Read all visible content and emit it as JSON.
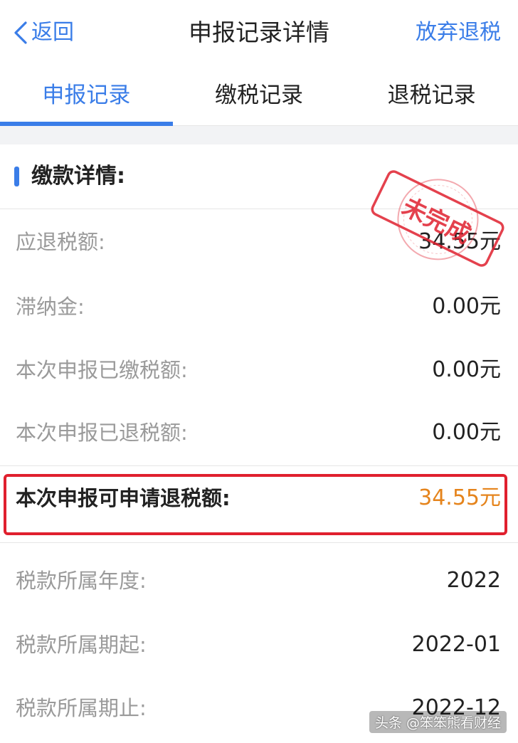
{
  "navbar": {
    "back_label": "返回",
    "title": "申报记录详情",
    "action_label": "放弃退税"
  },
  "tabs": [
    {
      "label": "申报记录",
      "active": true
    },
    {
      "label": "缴税记录",
      "active": false
    },
    {
      "label": "退税记录",
      "active": false
    }
  ],
  "section": {
    "title": "缴款详情:"
  },
  "stamp": {
    "text": "未完成",
    "color": "#e0202e"
  },
  "rows": [
    {
      "label": "应退税额:",
      "value": "34.55元"
    },
    {
      "label": "滞纳金:",
      "value": "0.00元"
    },
    {
      "label": "本次申报已缴税额:",
      "value": "0.00元"
    },
    {
      "label": "本次申报已退税额:",
      "value": "0.00元"
    },
    {
      "label": "本次申报可申请退税额:",
      "value": "34.55元",
      "highlighted": true
    },
    {
      "label": "税款所属年度:",
      "value": "2022"
    },
    {
      "label": "税款所属期起:",
      "value": "2022-01"
    },
    {
      "label": "税款所属期止:",
      "value": "2022-12"
    }
  ],
  "watermark": "头条 @笨笨熊看财经",
  "colors": {
    "accent": "#3a7de8",
    "highlight_border": "#e0202e",
    "highlight_value": "#e5841c"
  }
}
